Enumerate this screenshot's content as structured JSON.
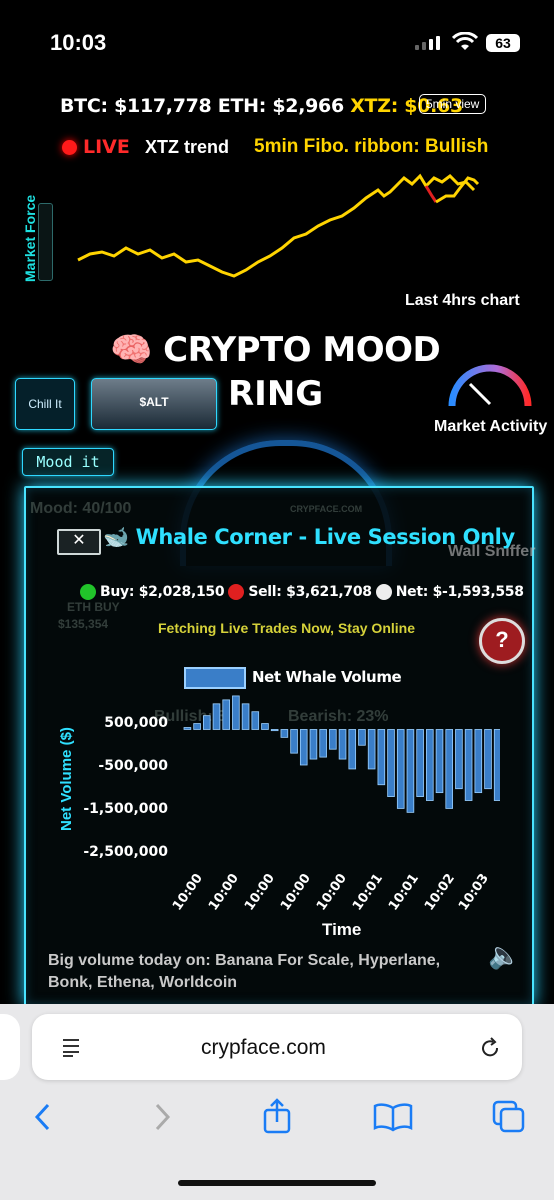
{
  "status_bar": {
    "time": "10:03",
    "battery": "63"
  },
  "prices": {
    "btc": "BTC: $117,778",
    "eth": "ETH: $2,966",
    "xtz": "XTZ: $0.63",
    "view_button": "5min view"
  },
  "trend": {
    "live": "LIVE",
    "label": "XTZ trend",
    "fibo": "5min Fibo. ribbon: Bullish",
    "market_force": "Market Force",
    "last_chart": "Last 4hrs chart"
  },
  "hero": {
    "title_line1": "🧠 CRYPTO MOOD",
    "title_line2": "RING",
    "chill_button": "Chill It",
    "alt_button": "$ALT",
    "market_activity": "Market Activity",
    "mood_button": "Mood it"
  },
  "background_ghost": {
    "mood": "Mood: 40/100",
    "wall_sniffer": "Wall Sniffer",
    "eth_buy": "ETH BUY",
    "eth_amount": "$135,354",
    "bullish": "Bullish: 3",
    "bearish": "Bearish: 23%",
    "site": "CRYPFACE.COM"
  },
  "whale": {
    "close": "✕",
    "title": "🐋 Whale Corner - Live Session Only",
    "buy": "Buy: $2,028,150",
    "sell": "Sell: $3,621,708",
    "net": "Net: $-1,593,558",
    "fetching": "Fetching Live Trades Now, Stay Online",
    "help": "?",
    "speaker": "🔈",
    "big_volume": "Big volume today on: Banana For Scale, Hyperlane, Bonk, Ethena, Worldcoin"
  },
  "colors": {
    "accent": "#2fe0ff",
    "bar": "#3a7ec8",
    "trend_up": "#ffd400",
    "trend_down": "#e02020"
  },
  "chart_data": {
    "type": "bar",
    "legend": [
      "Net Whale Volume"
    ],
    "ylabel": "Net Volume ($)",
    "xlabel": "Time",
    "yticks": [
      "500,000",
      "-500,000",
      "-1,500,000",
      "-2,500,000"
    ],
    "xticks": [
      "10:00",
      "10:00",
      "10:00",
      "10:00",
      "10:00",
      "10:01",
      "10:01",
      "10:02",
      "10:03"
    ],
    "series": [
      {
        "name": "Net Whale Volume",
        "values": [
          50000,
          150000,
          350000,
          650000,
          750000,
          850000,
          650000,
          450000,
          150000,
          -30000,
          -200000,
          -600000,
          -900000,
          -750000,
          -700000,
          -500000,
          -750000,
          -1000000,
          -400000,
          -1000000,
          -1400000,
          -1700000,
          -2000000,
          -2100000,
          -1700000,
          -1800000,
          -1600000,
          -2000000,
          -1500000,
          -1800000,
          -1600000,
          -1500000,
          -1800000
        ]
      }
    ],
    "ylim": [
      -2800000,
      1000000
    ]
  },
  "browser": {
    "url": "crypface.com"
  }
}
